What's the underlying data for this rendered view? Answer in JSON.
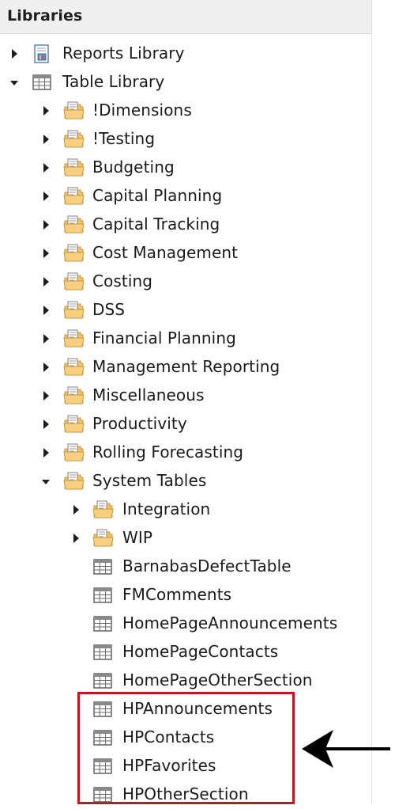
{
  "panel": {
    "title": "Libraries"
  },
  "tree": [
    {
      "label": "Reports Library",
      "depth": 0,
      "expander": "collapsed",
      "icon": "report-icon"
    },
    {
      "label": "Table Library",
      "depth": 0,
      "expander": "expanded",
      "icon": "table-icon"
    },
    {
      "label": "!Dimensions",
      "depth": 1,
      "expander": "collapsed",
      "icon": "folder-icon"
    },
    {
      "label": "!Testing",
      "depth": 1,
      "expander": "collapsed",
      "icon": "folder-icon"
    },
    {
      "label": "Budgeting",
      "depth": 1,
      "expander": "collapsed",
      "icon": "folder-icon"
    },
    {
      "label": "Capital Planning",
      "depth": 1,
      "expander": "collapsed",
      "icon": "folder-icon"
    },
    {
      "label": "Capital Tracking",
      "depth": 1,
      "expander": "collapsed",
      "icon": "folder-icon"
    },
    {
      "label": "Cost Management",
      "depth": 1,
      "expander": "collapsed",
      "icon": "folder-icon"
    },
    {
      "label": "Costing",
      "depth": 1,
      "expander": "collapsed",
      "icon": "folder-icon"
    },
    {
      "label": "DSS",
      "depth": 1,
      "expander": "collapsed",
      "icon": "folder-icon"
    },
    {
      "label": "Financial Planning",
      "depth": 1,
      "expander": "collapsed",
      "icon": "folder-icon"
    },
    {
      "label": "Management Reporting",
      "depth": 1,
      "expander": "collapsed",
      "icon": "folder-icon"
    },
    {
      "label": "Miscellaneous",
      "depth": 1,
      "expander": "collapsed",
      "icon": "folder-icon"
    },
    {
      "label": "Productivity",
      "depth": 1,
      "expander": "collapsed",
      "icon": "folder-icon"
    },
    {
      "label": "Rolling Forecasting",
      "depth": 1,
      "expander": "collapsed",
      "icon": "folder-icon"
    },
    {
      "label": "System Tables",
      "depth": 1,
      "expander": "expanded",
      "icon": "folder-icon"
    },
    {
      "label": "Integration",
      "depth": 2,
      "expander": "collapsed",
      "icon": "folder-icon"
    },
    {
      "label": "WIP",
      "depth": 2,
      "expander": "collapsed",
      "icon": "folder-icon"
    },
    {
      "label": "BarnabasDefectTable",
      "depth": 2,
      "expander": "none",
      "icon": "table-icon"
    },
    {
      "label": "FMComments",
      "depth": 2,
      "expander": "none",
      "icon": "table-icon"
    },
    {
      "label": "HomePageAnnouncements",
      "depth": 2,
      "expander": "none",
      "icon": "table-icon"
    },
    {
      "label": "HomePageContacts",
      "depth": 2,
      "expander": "none",
      "icon": "table-icon"
    },
    {
      "label": "HomePageOtherSection",
      "depth": 2,
      "expander": "none",
      "icon": "table-icon"
    },
    {
      "label": "HPAnnouncements",
      "depth": 2,
      "expander": "none",
      "icon": "table-icon"
    },
    {
      "label": "HPContacts",
      "depth": 2,
      "expander": "none",
      "icon": "table-icon"
    },
    {
      "label": "HPFavorites",
      "depth": 2,
      "expander": "none",
      "icon": "table-icon"
    },
    {
      "label": "HPOtherSection",
      "depth": 2,
      "expander": "none",
      "icon": "table-icon"
    }
  ],
  "colors": {
    "highlight_border": "#c0181f",
    "arrow": "#000000",
    "folder": "#f6c66b",
    "header_bg": "#f0f0f0"
  }
}
